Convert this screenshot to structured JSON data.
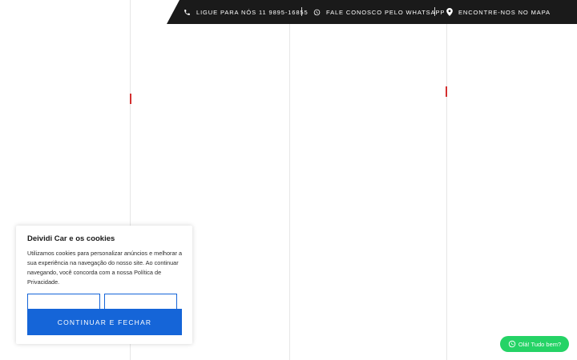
{
  "topbar": {
    "phone_label": "LIGUE PARA NÓS 11 9895-16855",
    "whatsapp_label": "FALE CONOSCO PELO WHATSAPP",
    "map_label": "ENCONTRE-NOS NO MAPA",
    "icons": [
      "phone-icon",
      "whatsapp-icon",
      "map-pin-icon"
    ]
  },
  "cookie": {
    "title": "Deividi Car e os cookies",
    "text": "Utilizamos cookies para personalizar anúncios e melhorar a sua experiência na navegação do nosso site. Ao continuar navegando, você concorda com a nossa",
    "link": "Política de Privacidade.",
    "button1_label": "",
    "button2_label": "",
    "accept_label": "CONTINUAR E FECHAR"
  },
  "chat": {
    "label": "Olá! Tudo bem?",
    "icon": "whatsapp-icon"
  },
  "colors": {
    "topbar_bg": "#1a1a1a",
    "primary_blue": "#1565d8",
    "whatsapp_green": "#25d366",
    "accent_red": "#d32f2f"
  }
}
